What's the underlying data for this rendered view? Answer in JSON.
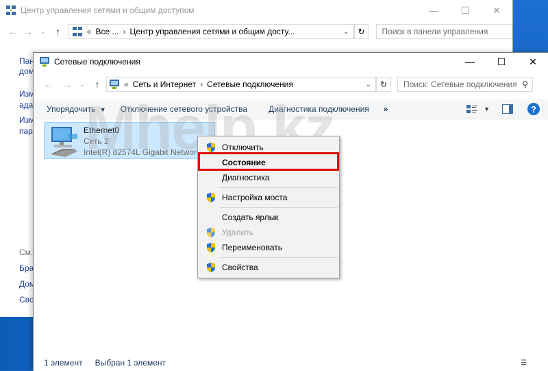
{
  "back_window": {
    "title": "Центр управления сетями и общим доступом",
    "address_prefix": "Все ...",
    "address_path": "Центр управления сетями и общим досту...",
    "search_placeholder": "Поиск в панели управления",
    "sidebar_links": [
      "Пан",
      "дом",
      "Изм",
      "ада",
      "Изм",
      "пар"
    ],
    "see_also": "См.",
    "bottom_links": [
      "Бра",
      "Дом",
      "Сво"
    ]
  },
  "front_window": {
    "title": "Сетевые подключения",
    "breadcrumb": [
      "Сеть и Интернет",
      "Сетевые подключения"
    ],
    "search_placeholder": "Поиск: Сетевые подключения",
    "toolbar": {
      "organize": "Упорядочить",
      "disable_device": "Отключение сетевого устройства",
      "diagnose": "Диагностика подключения",
      "more": "»"
    },
    "connection": {
      "name": "Ethernet0",
      "network": "Сеть  2",
      "adapter": "Intel(R) 82574L Gigabit Network ..."
    },
    "status": {
      "count": "1 элемент",
      "selected": "Выбран 1 элемент"
    }
  },
  "context_menu": {
    "items": [
      {
        "label": "Отключить"
      },
      {
        "label": "Состояние"
      },
      {
        "label": "Диагностика"
      },
      {
        "label": "Настройка моста"
      },
      {
        "label": "Создать ярлык"
      },
      {
        "label": "Удалить"
      },
      {
        "label": "Переименовать"
      },
      {
        "label": "Свойства"
      }
    ]
  },
  "watermark": "Mhelp.kz",
  "colors": {
    "highlight_border": "#e00000",
    "selection_bg": "#cce8ff",
    "desktop": "#1565c0",
    "link": "#1a3f9a"
  },
  "icons": [
    "network-connections-icon",
    "shield-icon",
    "refresh-icon",
    "help-icon",
    "layout-icon",
    "view-icon"
  ]
}
